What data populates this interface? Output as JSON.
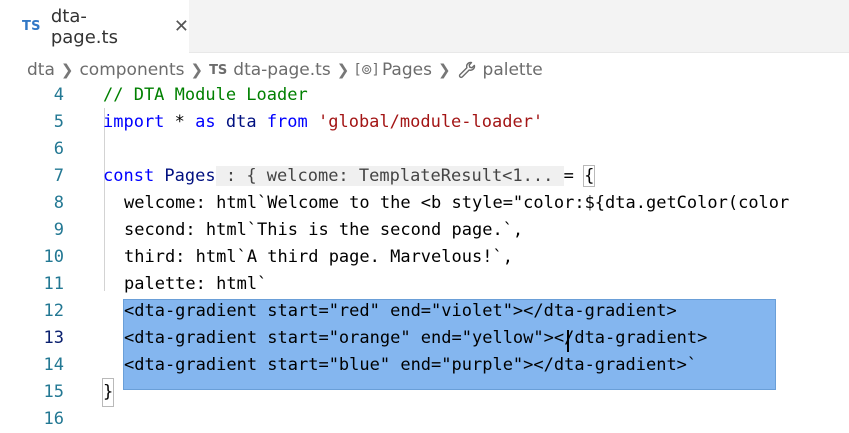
{
  "tab": {
    "badge": "TS",
    "title": "dta-page.ts",
    "close": "✕"
  },
  "breadcrumb": {
    "items": [
      "dta",
      "components",
      "dta-page.ts",
      "Pages",
      "palette"
    ],
    "ts_badge": "TS",
    "symbol_glyph": "[⊚]"
  },
  "editor": {
    "active_line": 13,
    "line_numbers": [
      "4",
      "5",
      "6",
      "7",
      "8",
      "9",
      "10",
      "11",
      "12",
      "13",
      "14",
      "15",
      "16"
    ],
    "l4": "// DTA Module Loader",
    "l5": {
      "kw1": "import",
      "star": " * ",
      "kw2": "as",
      "id": " dta ",
      "kw3": "from",
      "str": " 'global/module-loader'"
    },
    "l7": {
      "kw": "const",
      "id": " Pages",
      "hint": " : { welcome: TemplateResult<1... ",
      "rest": "= ",
      "brace": "{"
    },
    "l8": "welcome: html`Welcome to the <b style=\"color:${dta.getColor(color",
    "l9": "second: html`This is the second page.`,",
    "l10": "third: html`A third page. Marvelous!`,",
    "l11": "palette: html`",
    "l12": "<dta-gradient start=\"red\" end=\"violet\"></dta-gradient>",
    "l13": "<dta-gradient start=\"orange\" end=\"yellow\"></dta-gradient>",
    "l14": "<dta-gradient start=\"blue\" end=\"purple\"></dta-gradient>`",
    "l15": "}"
  }
}
